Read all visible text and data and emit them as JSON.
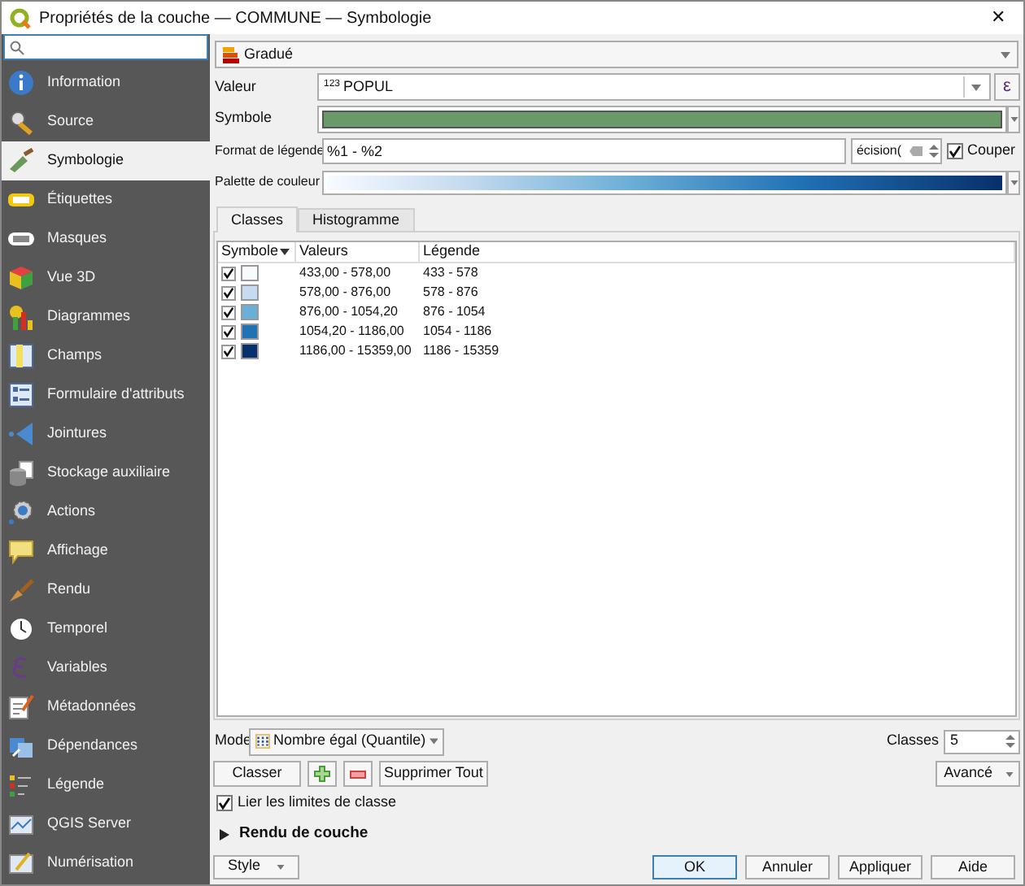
{
  "window": {
    "title": "Propriétés de la couche — COMMUNE — Symbologie",
    "close": "✕"
  },
  "sidebar": {
    "items": [
      {
        "label": "Information",
        "selected": false
      },
      {
        "label": "Source",
        "selected": false
      },
      {
        "label": "Symbologie",
        "selected": true
      },
      {
        "label": "Étiquettes",
        "selected": false
      },
      {
        "label": "Masques",
        "selected": false
      },
      {
        "label": "Vue 3D",
        "selected": false
      },
      {
        "label": "Diagrammes",
        "selected": false
      },
      {
        "label": "Champs",
        "selected": false
      },
      {
        "label": "Formulaire d'attributs",
        "selected": false
      },
      {
        "label": "Jointures",
        "selected": false
      },
      {
        "label": "Stockage auxiliaire",
        "selected": false
      },
      {
        "label": "Actions",
        "selected": false
      },
      {
        "label": "Affichage",
        "selected": false
      },
      {
        "label": "Rendu",
        "selected": false
      },
      {
        "label": "Temporel",
        "selected": false
      },
      {
        "label": "Variables",
        "selected": false
      },
      {
        "label": "Métadonnées",
        "selected": false
      },
      {
        "label": "Dépendances",
        "selected": false
      },
      {
        "label": "Légende",
        "selected": false
      },
      {
        "label": "QGIS Server",
        "selected": false
      },
      {
        "label": "Numérisation",
        "selected": false
      }
    ]
  },
  "renderer": {
    "value": "Gradué"
  },
  "form": {
    "value_label": "Valeur",
    "value_type": "123",
    "value": "POPUL",
    "expression_button": "ε",
    "symbol_label": "Symbole",
    "legend_format_label": "Format de légende",
    "legend_format": "%1 - %2",
    "precision": "écision(",
    "truncate": {
      "label": "Couper",
      "checked": true
    },
    "palette_label": "Palette de couleur"
  },
  "tabs": [
    {
      "label": "Classes",
      "selected": true
    },
    {
      "label": "Histogramme",
      "selected": false
    }
  ],
  "table": {
    "columns": [
      "Symbole",
      "Valeurs",
      "Légende"
    ],
    "rows": [
      {
        "checked": true,
        "color": "#f7fbff",
        "values": "433,00 - 578,00",
        "legend": "433 - 578"
      },
      {
        "checked": true,
        "color": "#c6dbef",
        "values": "578,00 - 876,00",
        "legend": "578 - 876"
      },
      {
        "checked": true,
        "color": "#6baed6",
        "values": "876,00 - 1054,20",
        "legend": "876 - 1054"
      },
      {
        "checked": true,
        "color": "#2171b5",
        "values": "1054,20 - 1186,00",
        "legend": "1054 - 1186"
      },
      {
        "checked": true,
        "color": "#08306b",
        "values": "1186,00 - 15359,00",
        "legend": "1186 - 15359"
      }
    ]
  },
  "mode": {
    "label": "Mode",
    "value": "Nombre égal (Quantile)",
    "classes_label": "Classes",
    "classes": "5"
  },
  "actions": {
    "classify": "Classer",
    "delete_all": "Supprimer Tout",
    "advanced": "Avancé"
  },
  "link_limits": {
    "label": "Lier les limites de classe",
    "checked": true
  },
  "layer_rendering": {
    "label": "Rendu de couche",
    "expanded": false
  },
  "footer": {
    "style": "Style",
    "buttons": [
      "OK",
      "Annuler",
      "Appliquer",
      "Aide"
    ]
  }
}
